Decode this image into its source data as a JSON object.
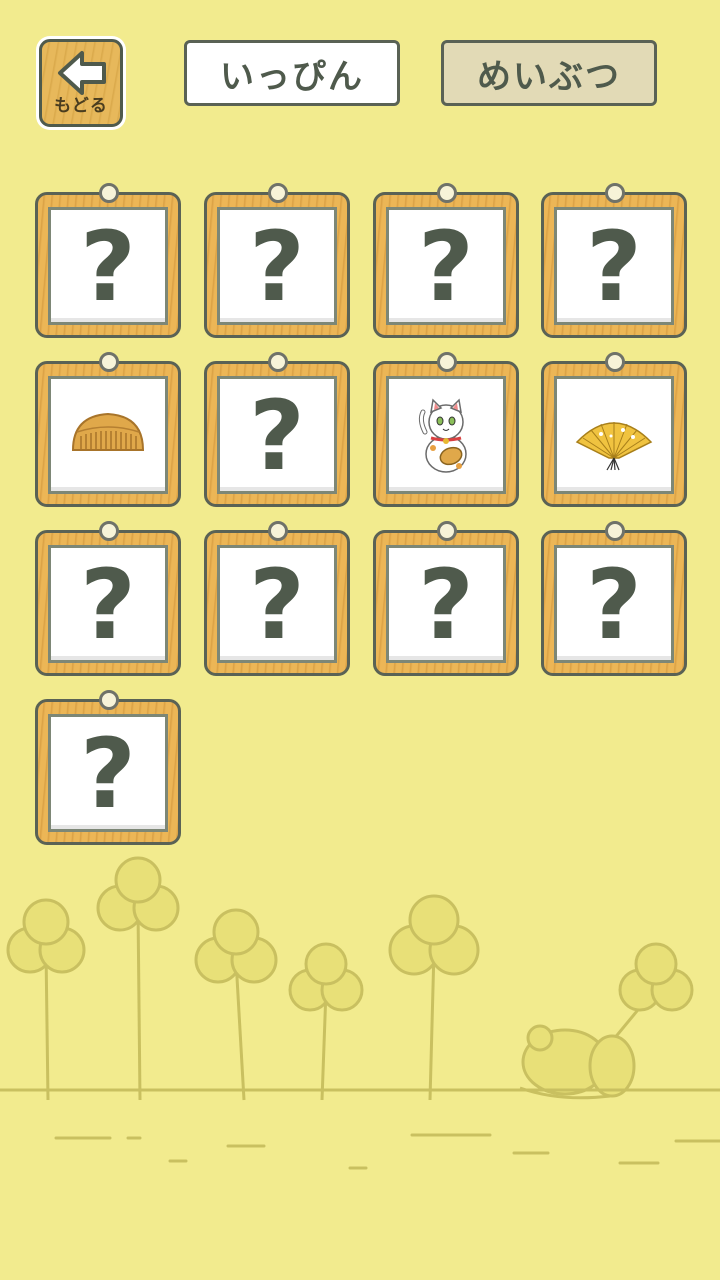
{
  "header": {
    "back_button": {
      "label": "もどる",
      "icon": "left-arrow-icon"
    },
    "tabs": [
      {
        "label": "いっぴん",
        "selected": true
      },
      {
        "label": "めいぶつ",
        "selected": false
      }
    ]
  },
  "cards": [
    {
      "state": "unknown",
      "text": "?"
    },
    {
      "state": "unknown",
      "text": "?"
    },
    {
      "state": "unknown",
      "text": "?"
    },
    {
      "state": "unknown",
      "text": "?"
    },
    {
      "state": "found",
      "icon": "wooden-comb-icon"
    },
    {
      "state": "unknown",
      "text": "?"
    },
    {
      "state": "found",
      "icon": "lucky-cat-icon"
    },
    {
      "state": "found",
      "icon": "folding-fan-icon"
    },
    {
      "state": "unknown",
      "text": "?"
    },
    {
      "state": "unknown",
      "text": "?"
    },
    {
      "state": "unknown",
      "text": "?"
    },
    {
      "state": "unknown",
      "text": "?"
    },
    {
      "state": "unknown",
      "text": "?"
    }
  ],
  "colors": {
    "background": "#f2eb8e",
    "frame_wood": "#ecb656",
    "outline": "#4f5a4c",
    "tab_active": "#ffffff",
    "tab_inactive": "#e2dab6",
    "scenery_line": "#c9c060"
  },
  "scenery": {
    "icons": [
      "clover-icon",
      "frog-icon"
    ]
  }
}
